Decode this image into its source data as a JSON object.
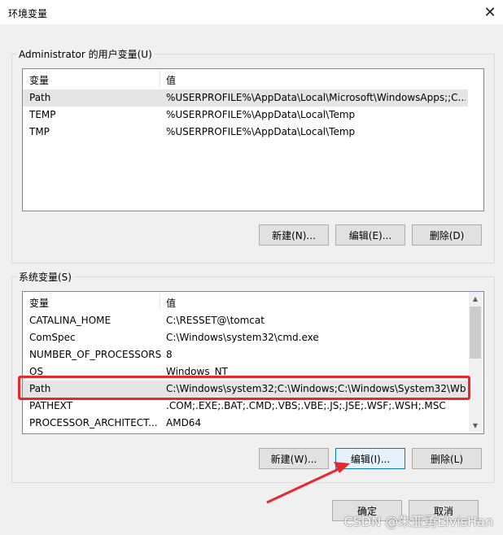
{
  "window": {
    "title": "环境变量",
    "close_icon": "close-icon"
  },
  "user_vars": {
    "group_label": "Administrator 的用户变量(U)",
    "columns": [
      "变量",
      "值"
    ],
    "rows": [
      {
        "name": "Path",
        "value": "%USERPROFILE%\\AppData\\Local\\Microsoft\\WindowsApps;;C..."
      },
      {
        "name": "TEMP",
        "value": "%USERPROFILE%\\AppData\\Local\\Temp"
      },
      {
        "name": "TMP",
        "value": "%USERPROFILE%\\AppData\\Local\\Temp"
      }
    ],
    "buttons": {
      "new": "新建(N)...",
      "edit": "编辑(E)...",
      "delete": "删除(D)"
    }
  },
  "system_vars": {
    "group_label": "系统变量(S)",
    "columns": [
      "变量",
      "值"
    ],
    "rows": [
      {
        "name": "CATALINA_HOME",
        "value": "C:\\RESSET@\\tomcat"
      },
      {
        "name": "ComSpec",
        "value": "C:\\Windows\\system32\\cmd.exe"
      },
      {
        "name": "NUMBER_OF_PROCESSORS",
        "value": "8"
      },
      {
        "name": "OS",
        "value": "Windows_NT"
      },
      {
        "name": "Path",
        "value": "C:\\Windows\\system32;C:\\Windows;C:\\Windows\\System32\\Wb..."
      },
      {
        "name": "PATHEXT",
        "value": ".COM;.EXE;.BAT;.CMD;.VBS;.VBE;.JS;.JSE;.WSF;.WSH;.MSC"
      },
      {
        "name": "PROCESSOR_ARCHITECT...",
        "value": "AMD64"
      }
    ],
    "buttons": {
      "new": "新建(W)...",
      "edit": "编辑(I)...",
      "delete": "删除(L)"
    }
  },
  "footer": {
    "ok": "确定",
    "cancel": "取消"
  },
  "annotation_color": "#e8282b",
  "watermark": "CSDN @朱亚勇ElvisHan"
}
